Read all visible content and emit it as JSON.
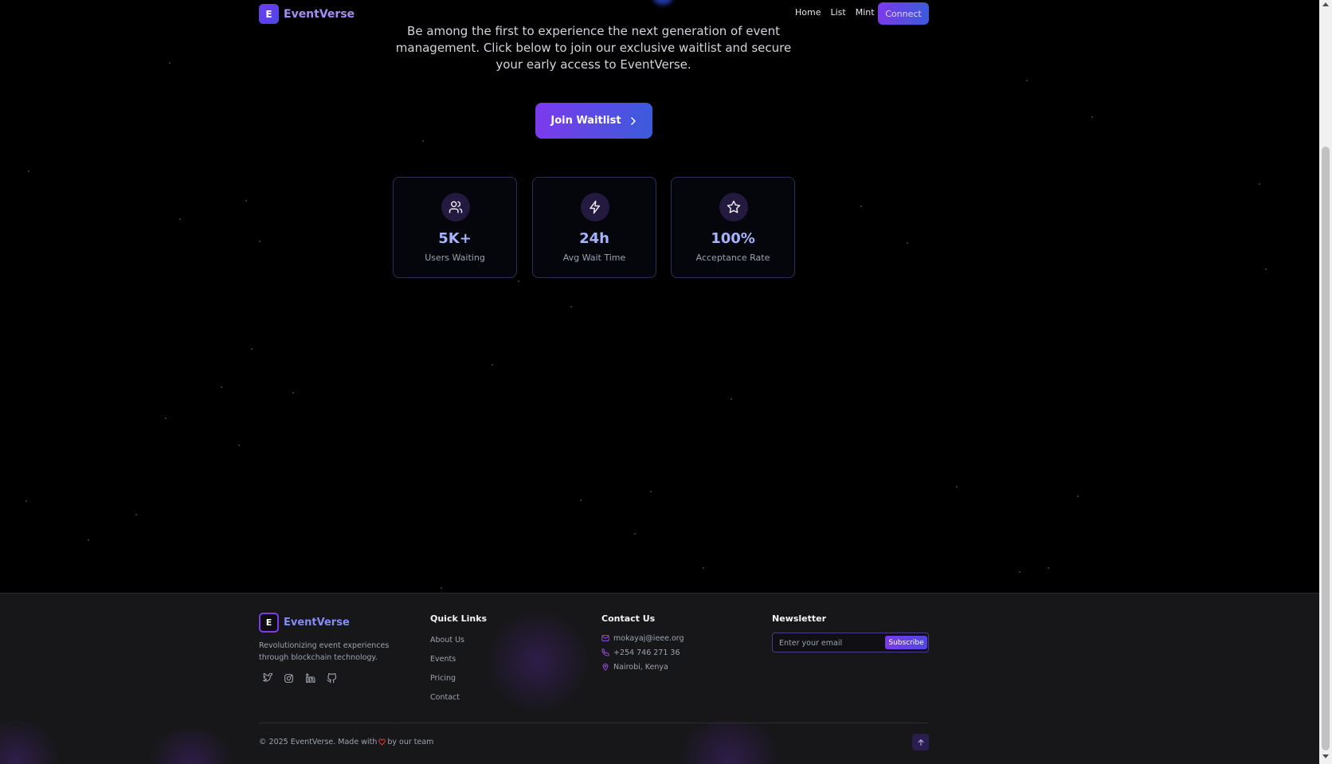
{
  "header": {
    "logo_letter": "E",
    "brand": "EventVerse",
    "nav": [
      "Home",
      "List",
      "Mint"
    ],
    "connect_label": "Connect"
  },
  "hero": {
    "text": "Be among the first to experience the next generation of event management. Click below to join our exclusive waitlist and secure your early access to EventVerse.",
    "cta_label": "Join Waitlist"
  },
  "stats": [
    {
      "icon": "users-icon",
      "value": "5K+",
      "label": "Users Waiting"
    },
    {
      "icon": "zap-icon",
      "value": "24h",
      "label": "Avg Wait Time"
    },
    {
      "icon": "star-icon",
      "value": "100%",
      "label": "Acceptance Rate"
    }
  ],
  "footer": {
    "logo_letter": "E",
    "brand": "EventVerse",
    "tagline": "Revolutionizing event experiences through blockchain technology.",
    "socials": [
      "twitter-icon",
      "instagram-icon",
      "linkedin-icon",
      "github-icon"
    ],
    "quick_links_title": "Quick Links",
    "quick_links": [
      "About Us",
      "Events",
      "Pricing",
      "Contact"
    ],
    "contact_title": "Contact Us",
    "contact": {
      "email": "mokayaj@ieee.org",
      "phone": "+254 746 271 36",
      "location": "Nairobi, Kenya"
    },
    "newsletter_title": "Newsletter",
    "newsletter_placeholder": "Enter your email",
    "subscribe_label": "Subscribe",
    "copyright_before": "© 2025 EventVerse. Made with",
    "copyright_after": "by our team"
  },
  "colors": {
    "accent_purple": "#7c3aed",
    "accent_blue": "#3b5bdb",
    "stat_value": "#a5b4fc",
    "background": "#000000",
    "footer_bg": "#17171a"
  }
}
